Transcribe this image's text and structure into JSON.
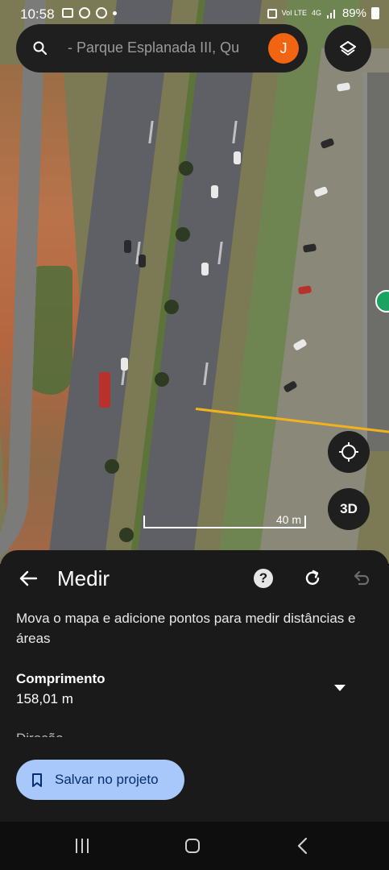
{
  "status_bar": {
    "time": "10:58",
    "network": "4G",
    "volte": "VoI LTE",
    "battery": "89%"
  },
  "search": {
    "text": "- Parque Esplanada III,  Qu",
    "avatar_initial": "J",
    "avatar_color": "#f16411"
  },
  "map": {
    "scale_label": "40 m",
    "button_3d_label": "3D",
    "measure_line_color": "#f2b21b"
  },
  "sheet": {
    "title": "Medir",
    "help_label": "?",
    "description": "Mova o mapa e adicione pontos para medir distâncias e áreas",
    "length_label": "Comprimento",
    "length_value": "158,01 m",
    "cut_label": "Direção",
    "save_button_label": "Salvar no projeto"
  },
  "icons": {
    "search": "search-icon",
    "layers": "layers-icon",
    "locate": "my-location-icon",
    "back": "arrow-back-icon",
    "redo": "redo-icon",
    "undo": "undo-icon",
    "bookmark": "bookmark-icon"
  },
  "colors": {
    "save_button_bg": "#a8c7fa",
    "sheet_bg": "#1a1a1a"
  }
}
